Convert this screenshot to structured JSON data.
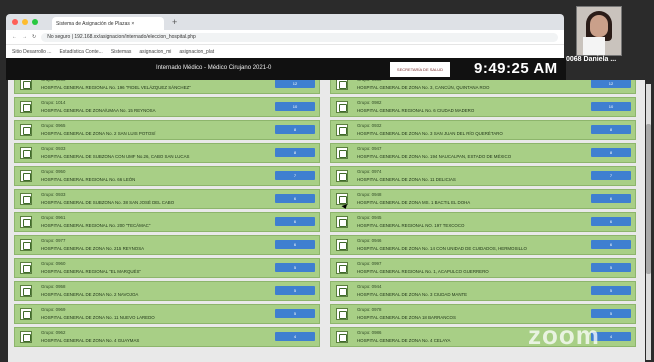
{
  "browser": {
    "tab_title": "Sistema de Asignación de Plazas ×",
    "url": "No seguro  |  192.168.xx/asignacion/internado/eleccion_hospital.php",
    "bookmarks": [
      "Sitio Desarrollo ...",
      "Estadística Conte...",
      "Sistemas",
      "asignacion_mi",
      "asignacion_plat"
    ]
  },
  "app": {
    "title": "Internado Médico - Médico Cirujano 2021-0",
    "logo_text": "SECRETARÍA DE SALUD",
    "clock": "9:49:25 AM",
    "user": "0068 Daniela ..."
  },
  "overlay": {
    "zoom": "zoom"
  },
  "list": {
    "rows": [
      {
        "left": {
          "group": "Grupo: 0960",
          "hospital": "HOSPITAL GENERAL REGIONAL No. 196 \"FIDEL VELÁZQUEZ SÁNCHEZ\"",
          "button": "12"
        },
        "right": {
          "group": "Grupo: 0980",
          "hospital": "HOSPITAL GENERAL DE ZONA No. 3, CANCÚN, QUINTANA ROO",
          "button": "12"
        }
      },
      {
        "left": {
          "group": "Grupo: 1014",
          "hospital": "HOSPITAL GENERAL DE ZONA/UMAA No. 15 REYNOSA",
          "button": "10"
        },
        "right": {
          "group": "Grupo: 0982",
          "hospital": "HOSPITAL GENERAL REGIONAL No. 6 CIUDAD MADERO",
          "button": "10"
        }
      },
      {
        "left": {
          "group": "Grupo: 0965",
          "hospital": "HOSPITAL GENERAL DE ZONA No. 2 SAN LUIS POTOSÍ",
          "button": "8"
        },
        "right": {
          "group": "Grupo: 0932",
          "hospital": "HOSPITAL GENERAL DE ZONA No. 3 SAN JUAN DEL RÍO QUERÉTARO",
          "button": "8"
        }
      },
      {
        "left": {
          "group": "Grupo: 0933",
          "hospital": "HOSPITAL GENERAL DE SUBZONA CON UMF No.26, CABO SAN LUCAS",
          "button": "8"
        },
        "right": {
          "group": "Grupo: 0947",
          "hospital": "HOSPITAL GENERAL DE ZONA No. 194 NAUCALPAN, ESTADO DE MÉXICO",
          "button": "8"
        }
      },
      {
        "left": {
          "group": "Grupo: 0950",
          "hospital": "HOSPITAL GENERAL REGIONAL No. 66 LEÓN",
          "button": "7"
        },
        "right": {
          "group": "Grupo: 0974",
          "hospital": "HOSPITAL GENERAL DE ZONA No. 11 DELICIAS",
          "button": "7"
        }
      },
      {
        "left": {
          "group": "Grupo: 0933",
          "hospital": "HOSPITAL GENERAL DE SUBZONA No. 38 SAN JOSÉ DEL CABO",
          "button": "6"
        },
        "right": {
          "group": "Grupo: 0948",
          "hospital": "HOSPITAL GENERAL DE ZONA MS. 1 BACTIL EL DOHA",
          "button": "6"
        }
      },
      {
        "left": {
          "group": "Grupo: 0961",
          "hospital": "HOSPITAL GENERAL REGIONAL No. 200 \"TECÁMAC\"",
          "button": "6"
        },
        "right": {
          "group": "Grupo: 0945",
          "hospital": "HOSPITAL GENERAL REGIONAL NO. 197 TEXCOCO",
          "button": "6"
        }
      },
      {
        "left": {
          "group": "Grupo: 0977",
          "hospital": "HOSPITAL GENERAL DE ZONA No. 215 REYNOSA",
          "button": "6"
        },
        "right": {
          "group": "Grupo: 0946",
          "hospital": "HOSPITAL GENERAL DE ZONA No. 14 CON UNIDAD DE CUIDADOS, HERMOSILLO",
          "button": "6"
        }
      },
      {
        "left": {
          "group": "Grupo: 0960",
          "hospital": "HOSPITAL GENERAL REGIONAL \"EL MARQUÉS\"",
          "button": "5"
        },
        "right": {
          "group": "Grupo: 0997",
          "hospital": "HOSPITAL GENERAL REGIONAL No. 1, ACAPULCO GUERRERO",
          "button": "5"
        }
      },
      {
        "left": {
          "group": "Grupo: 0958",
          "hospital": "HOSPITAL GENERAL DE ZONA No. 2 NAVOJOA",
          "button": "5"
        },
        "right": {
          "group": "Grupo: 0944",
          "hospital": "HOSPITAL GENERAL DE ZONA No. 3 CIUDAD MANTE",
          "button": "5"
        }
      },
      {
        "left": {
          "group": "Grupo: 0969",
          "hospital": "HOSPITAL GENERAL DE ZONA No. 11 NUEVO LAREDO",
          "button": "5"
        },
        "right": {
          "group": "Grupo: 0978",
          "hospital": "HOSPITAL GENERAL DE ZONA 18 BARRANCOS",
          "button": "5"
        }
      },
      {
        "left": {
          "group": "Grupo: 0962",
          "hospital": "HOSPITAL GENERAL DE ZONA No. 4 GUAYMAS",
          "button": "4"
        },
        "right": {
          "group": "Grupo: 0986",
          "hospital": "HOSPITAL GENERAL DE ZONA No. 4 CELAYA",
          "button": "4"
        }
      }
    ]
  }
}
